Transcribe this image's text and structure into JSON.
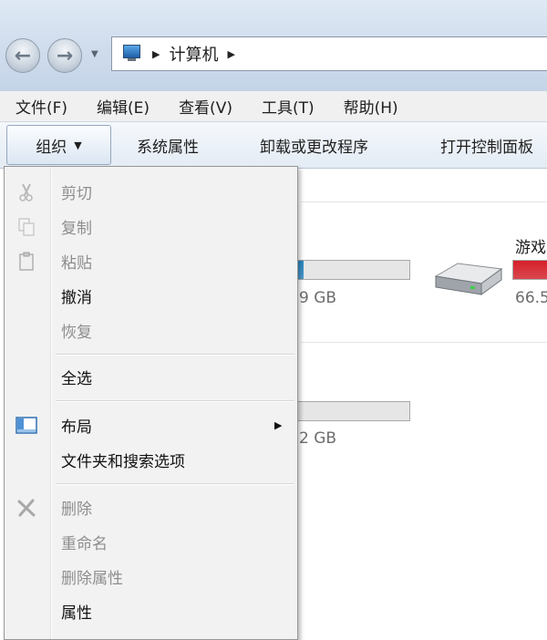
{
  "address": {
    "crumbs": [
      "计算机"
    ],
    "icon": "computer-icon"
  },
  "menubar": {
    "items": [
      "文件(F)",
      "编辑(E)",
      "查看(V)",
      "工具(T)",
      "帮助(H)"
    ]
  },
  "commandbar": {
    "organize": "组织",
    "system_properties": "系统属性",
    "uninstall": "卸载或更改程序",
    "control_panel": "打开控制面板"
  },
  "drives": [
    {
      "size_text": "9 GB",
      "fill_fraction": 0.16,
      "fill_color": "#2a8ac8"
    },
    {
      "label": "游戏",
      "size_text": "66.5",
      "fill_fraction": 0.9,
      "fill_color": "#d6202a"
    },
    {
      "size_text": "2 GB",
      "fill_fraction": 0.0,
      "fill_color": "#2a8ac8"
    }
  ],
  "organize_menu": {
    "cut": "剪切",
    "copy": "复制",
    "paste": "粘贴",
    "undo": "撤消",
    "redo": "恢复",
    "select_all": "全选",
    "layout": "布局",
    "folder_options": "文件夹和搜索选项",
    "delete": "删除",
    "rename": "重命名",
    "remove_properties": "删除属性",
    "properties": "属性"
  },
  "colors": {
    "disabled_text": "#8e8e8e",
    "menu_bg": "#f2f2f2",
    "usage_blue": "#2a8ac8",
    "usage_red": "#d6202a"
  }
}
